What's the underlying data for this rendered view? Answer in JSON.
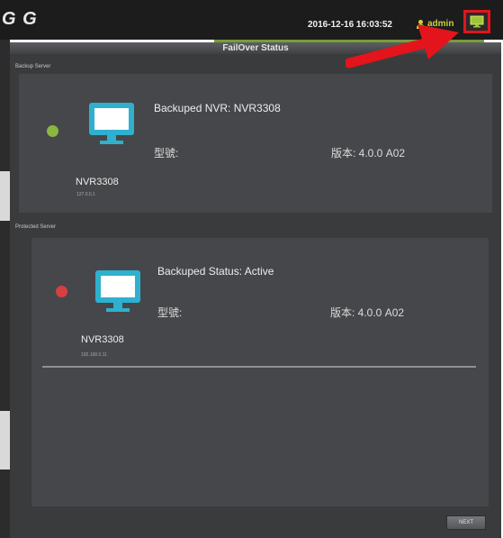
{
  "header": {
    "logo": "G G",
    "datetime": "2016-12-16 16:03:52",
    "username": "admin",
    "failover_icon": "monitor-failover-icon"
  },
  "dialog": {
    "title": "FailOver Status",
    "backup": {
      "section_label": "Backup Server",
      "headline": "Backuped NVR: NVR3308",
      "model_label": "型號:",
      "version": "版本: 4.0.0 A02",
      "name": "NVR3308",
      "ip": "127.0.0.1",
      "status_color": "#8ab642"
    },
    "protected": {
      "section_label": "Protected Server",
      "headline": "Backuped Status: Active",
      "model_label": "型號:",
      "version": "版本: 4.0.0 A02",
      "name": "NVR3308",
      "ip": "192.168.0.11",
      "status_color": "#d64040"
    },
    "next_label": "NEXT"
  },
  "colors": {
    "highlight": "#e3141b",
    "monitor": "#2fb0cf"
  }
}
